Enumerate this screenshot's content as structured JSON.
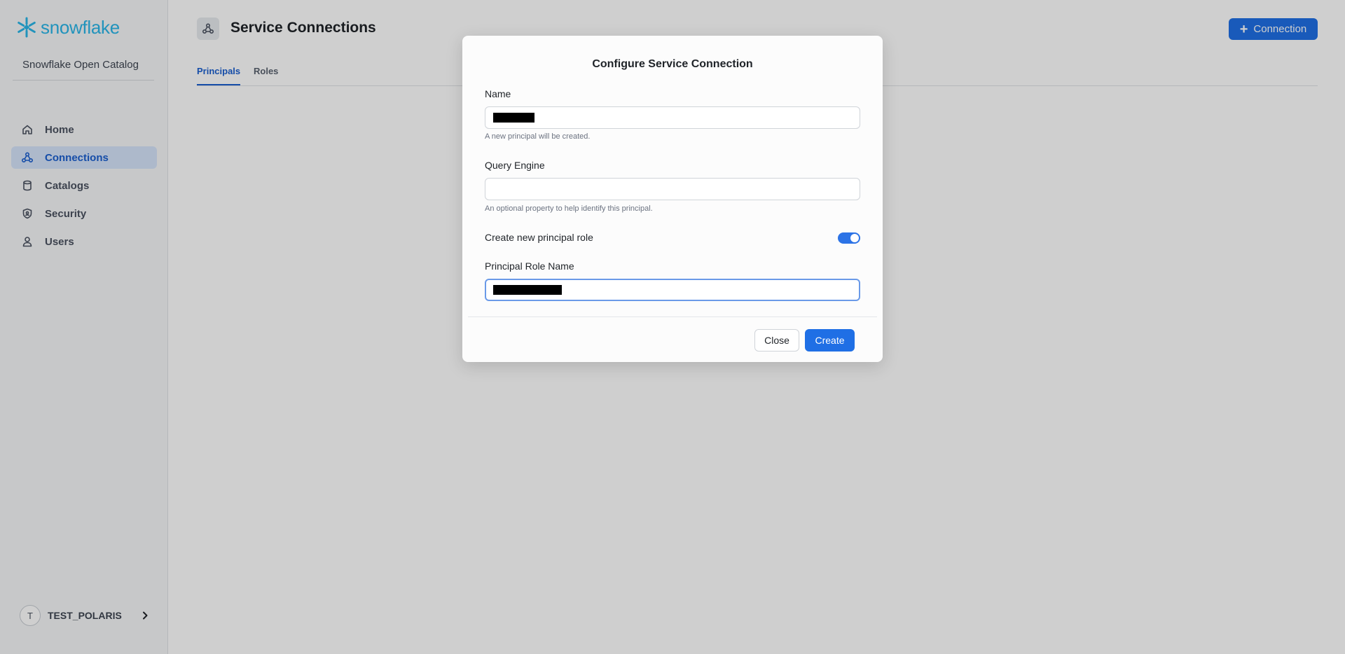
{
  "app": {
    "logo_text": "snowflake",
    "org_name": "Snowflake Open Catalog",
    "brand_color": "#29b5e8",
    "accent_color": "#1f6fe5"
  },
  "sidebar": {
    "items": [
      {
        "label": "Home",
        "icon": "home-icon",
        "active": false
      },
      {
        "label": "Connections",
        "icon": "connections-icon",
        "active": true
      },
      {
        "label": "Catalogs",
        "icon": "database-icon",
        "active": false
      },
      {
        "label": "Security",
        "icon": "shield-icon",
        "active": false
      },
      {
        "label": "Users",
        "icon": "user-icon",
        "active": false
      }
    ],
    "user": {
      "initial": "T",
      "name": "TEST_POLARIS"
    }
  },
  "header": {
    "title": "Service Connections",
    "add_button_label": "Connection",
    "tabs": [
      {
        "label": "Principals",
        "active": true
      },
      {
        "label": "Roles",
        "active": false
      }
    ]
  },
  "modal": {
    "title": "Configure Service Connection",
    "name_label": "Name",
    "name_help": "A new principal will be created.",
    "query_engine_label": "Query Engine",
    "query_engine_value": "",
    "query_engine_help": "An optional property to help identify this principal.",
    "toggle_label": "Create new principal role",
    "toggle_on": true,
    "role_name_label": "Principal Role Name",
    "close_label": "Close",
    "create_label": "Create"
  }
}
